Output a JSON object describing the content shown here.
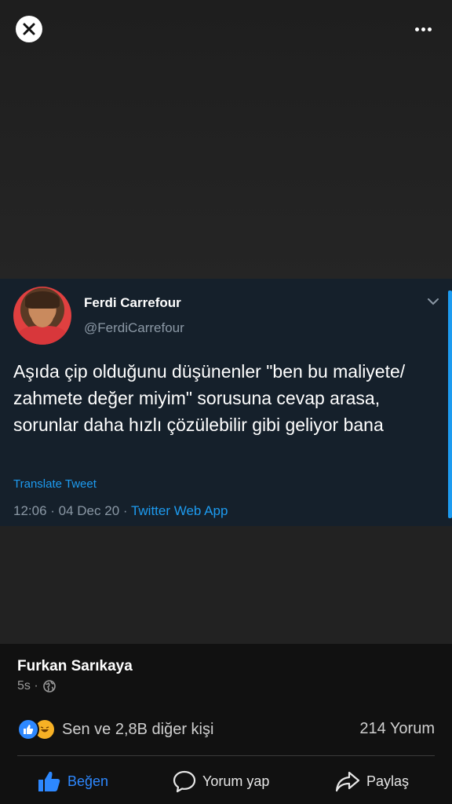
{
  "viewer": {
    "close_icon": "close-icon",
    "more_icon": "more-options-icon"
  },
  "tweet": {
    "name": "Ferdi Carrefour",
    "handle": "@FerdiCarrefour",
    "text": "Aşıda çip olduğunu düşünenler \"ben bu maliyete/ zahmete değer miyim\" sorusuna cevap arasa, sorunlar daha hızlı çözülebilir gibi geliyor bana",
    "translate_label": "Translate Tweet",
    "time_date": "12:06 · 04 Dec 20 · ",
    "app": "Twitter Web App"
  },
  "post": {
    "author": "Furkan Sarıkaya",
    "time": "5s ·",
    "reactions_text": "Sen ve 2,8B diğer kişi",
    "comments_count": "214 Yorum"
  },
  "actions": {
    "like_label": "Beğen",
    "comment_label": "Yorum yap",
    "share_label": "Paylaş"
  },
  "colors": {
    "accent": "#2d88ff",
    "twitter_blue": "#1d9bf0",
    "tweet_bg": "#15202b"
  }
}
